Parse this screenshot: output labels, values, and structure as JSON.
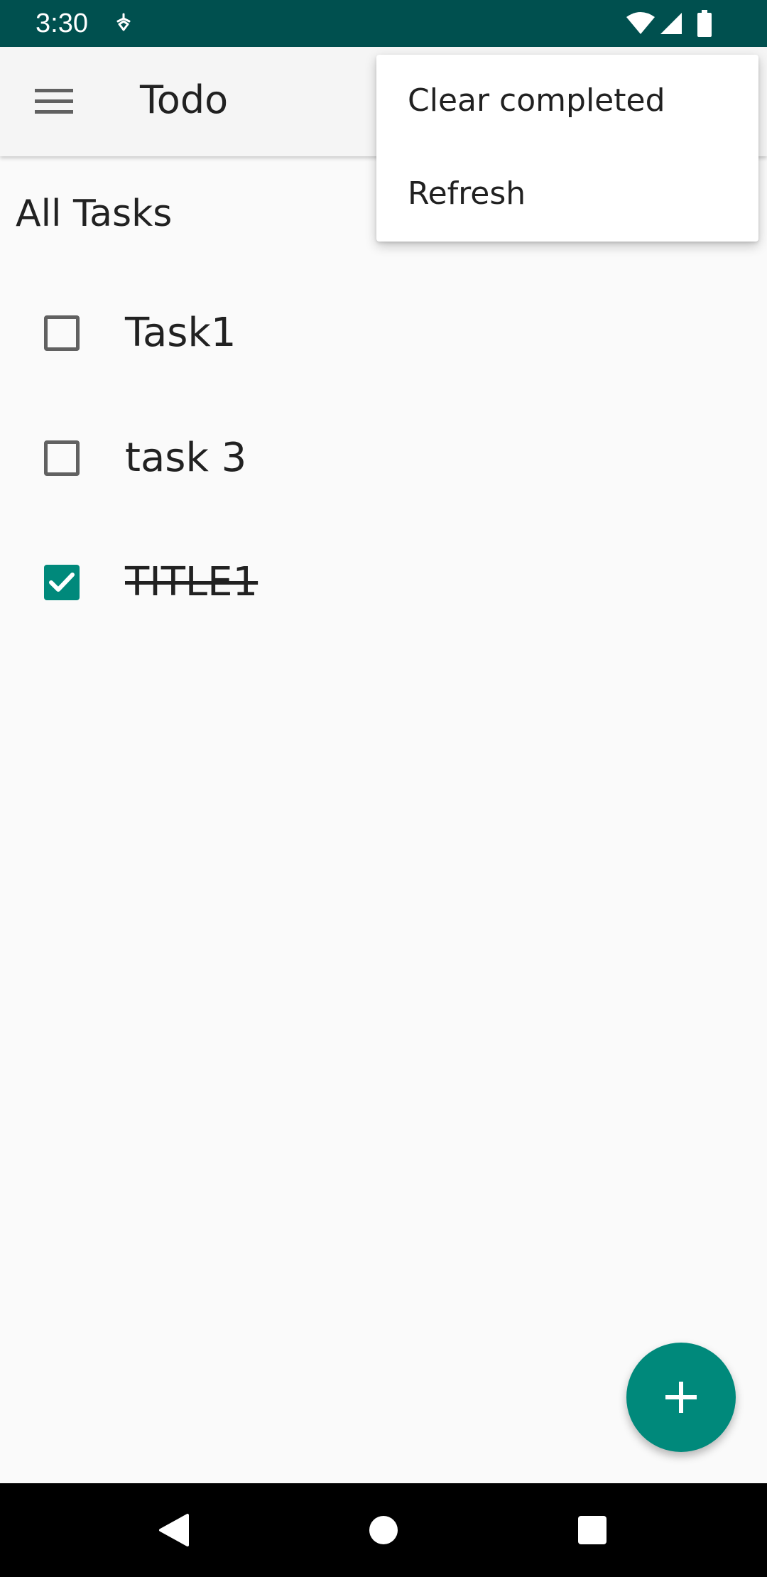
{
  "status_bar": {
    "time": "3:30",
    "background_color": "#00504f",
    "icons": [
      "notification-icon",
      "wifi-icon",
      "signal-icon",
      "battery-icon"
    ]
  },
  "app_bar": {
    "title": "Todo",
    "menu_icon": "hamburger-menu-icon"
  },
  "overflow_menu": {
    "items": [
      {
        "label": "Clear completed"
      },
      {
        "label": "Refresh"
      }
    ]
  },
  "content": {
    "filter_label": "All Tasks",
    "tasks": [
      {
        "title": "Task1",
        "completed": false
      },
      {
        "title": "task 3",
        "completed": false
      },
      {
        "title": "TITLE1",
        "completed": true
      }
    ]
  },
  "fab": {
    "icon": "add-icon",
    "color": "#00897b"
  },
  "nav_bar": {
    "buttons": [
      "back-icon",
      "home-icon",
      "recents-icon"
    ]
  }
}
